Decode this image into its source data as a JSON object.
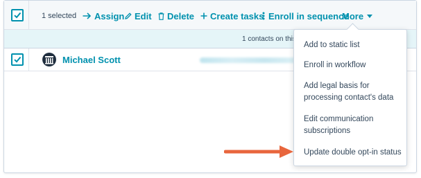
{
  "toolbar": {
    "selected_text": "1 selected",
    "actions": [
      {
        "label": "Assign",
        "icon": "arrow-right-icon"
      },
      {
        "label": "Edit",
        "icon": "pencil-icon"
      },
      {
        "label": "Delete",
        "icon": "trash-icon"
      },
      {
        "label": "Create tasks",
        "icon": "plus-icon"
      },
      {
        "label": "Enroll in sequence",
        "icon": "sequence-icon"
      }
    ],
    "more_label": "More",
    "select_all_checked": true
  },
  "info_bar": {
    "text": "1 contacts on this"
  },
  "table": {
    "rows": [
      {
        "name": "Michael Scott",
        "checked": true,
        "avatar": "company-logo-icon"
      }
    ]
  },
  "more_menu": {
    "items": [
      {
        "label": "Add to static list"
      },
      {
        "label": "Enroll in workflow"
      },
      {
        "label": "Add legal basis for processing contact's data"
      },
      {
        "label": "Edit communication subscriptions"
      },
      {
        "label": "Update double opt-in status"
      }
    ],
    "highlighted_item": "Update double opt-in status"
  },
  "colors": {
    "accent": "#0091ae",
    "text": "#33475b",
    "info_bar_bg": "#e5f5f8",
    "toolbar_bg": "#f5f8fa",
    "annotation_arrow": "#e8663d"
  }
}
